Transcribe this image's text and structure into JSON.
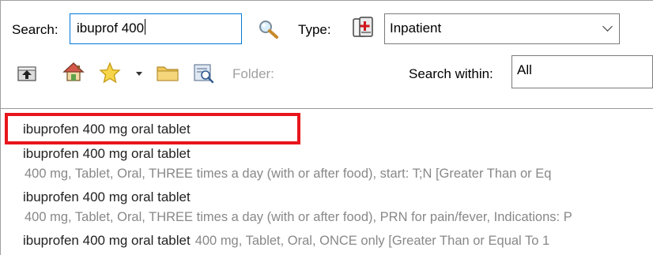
{
  "search": {
    "label": "Search:",
    "value": "ibuprof 400",
    "icon": "magnifier-icon"
  },
  "type": {
    "label": "Type:",
    "icon": "medication-icon",
    "selected": "Inpatient"
  },
  "toolbar": {
    "icons": [
      "up-folder-icon",
      "home-icon",
      "star-icon",
      "dropdown-arrow-icon",
      "folder-icon",
      "search-folder-icon"
    ],
    "folder_label": "Folder:",
    "search_within_label": "Search within:",
    "search_within_value": "All"
  },
  "results": [
    {
      "title": "ibuprofen 400 mg oral tablet",
      "detail": ""
    },
    {
      "title": "ibuprofen 400 mg oral tablet",
      "detail": "400 mg, Tablet, Oral, THREE times a day (with or after food), start: T;N [Greater Than or Eq"
    },
    {
      "title": "ibuprofen 400 mg oral tablet",
      "detail": "400 mg, Tablet, Oral, THREE times a day (with or after food), PRN for pain/fever, Indications: P"
    },
    {
      "title": "ibuprofen 400 mg oral tablet",
      "detail": "400 mg, Tablet, Oral, ONCE only [Greater Than or Equal To 1"
    }
  ],
  "colors": {
    "highlight": "#e8161c",
    "focus_border": "#0078d7",
    "detail_text": "#888888"
  }
}
